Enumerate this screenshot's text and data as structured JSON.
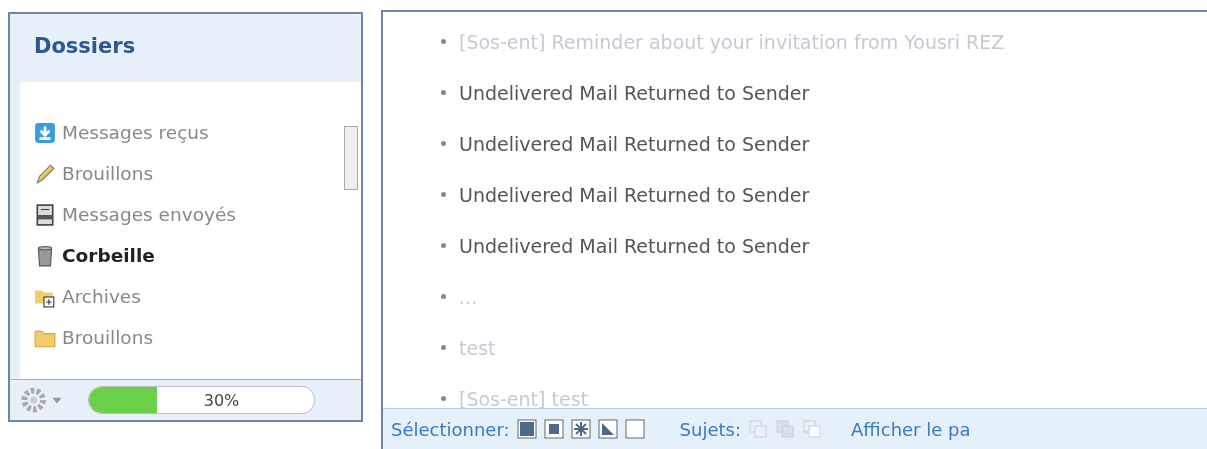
{
  "sidebar": {
    "title": "Dossiers",
    "folders": [
      {
        "label": "Messages reçus",
        "kind": "inbox",
        "selected": false
      },
      {
        "label": "Brouillons",
        "kind": "pencil",
        "selected": false
      },
      {
        "label": "Messages envoyés",
        "kind": "outbox",
        "selected": false
      },
      {
        "label": "Corbeille",
        "kind": "trash",
        "selected": true
      },
      {
        "label": "Archives",
        "kind": "folder-plus",
        "selected": false
      },
      {
        "label": "Brouillons",
        "kind": "folder",
        "selected": false
      }
    ],
    "quota": {
      "level": 0.3,
      "reading": "30%"
    }
  },
  "messages": [
    {
      "subject": "[Sos-ent] Reminder about your invitation from Yousri REZ",
      "faded": true
    },
    {
      "subject": "Undelivered Mail Returned to Sender",
      "faded": false
    },
    {
      "subject": "Undelivered Mail Returned to Sender",
      "faded": false
    },
    {
      "subject": "Undelivered Mail Returned to Sender",
      "faded": false
    },
    {
      "subject": "Undelivered Mail Returned to Sender",
      "faded": false
    },
    {
      "subject": "...",
      "faded": true
    },
    {
      "subject": "test",
      "faded": true
    },
    {
      "subject": "[Sos-ent] test",
      "faded": true
    }
  ],
  "footer": {
    "select_label": "Sélectionner:",
    "threads_label": "Sujets:",
    "link": "Afficher le pa"
  }
}
